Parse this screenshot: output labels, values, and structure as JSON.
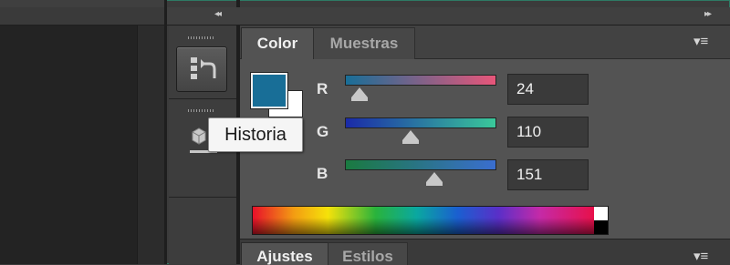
{
  "dock": {
    "collapse_left": "◂◂",
    "collapse_right": "▸▸"
  },
  "tooltip": {
    "text": "Historia"
  },
  "color_panel": {
    "tabs": [
      {
        "label": "Color",
        "active": true
      },
      {
        "label": "Muestras",
        "active": false
      }
    ],
    "menu_icon": "▾≡",
    "foreground_color": "#186e97",
    "background_color": "#ffffff",
    "channels": [
      {
        "label": "R",
        "value": "24",
        "fraction": 0.094,
        "gradient": [
          "#186e97",
          "#e8567a"
        ]
      },
      {
        "label": "G",
        "value": "110",
        "fraction": 0.431,
        "gradient": [
          "#1a2aa8",
          "#3ac89a"
        ]
      },
      {
        "label": "B",
        "value": "151",
        "fraction": 0.592,
        "gradient": [
          "#1a7a40",
          "#3a6ed0"
        ]
      }
    ]
  },
  "bottom_panel": {
    "tabs": [
      {
        "label": "Ajustes",
        "active": true
      },
      {
        "label": "Estilos",
        "active": false
      }
    ],
    "menu_icon": "▾≡"
  }
}
